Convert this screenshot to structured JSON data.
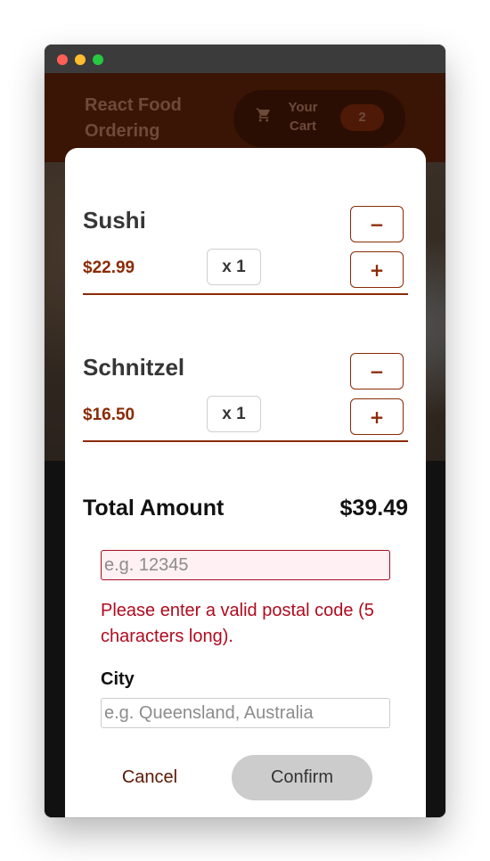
{
  "header": {
    "title": "React Food Ordering",
    "cart_button": {
      "label": "Your Cart",
      "badge": "2",
      "icon": "cart-icon"
    }
  },
  "cart": {
    "items": [
      {
        "name": "Sushi",
        "price": "$22.99",
        "quantity": "x 1",
        "remove_label": "−",
        "add_label": "+"
      },
      {
        "name": "Schnitzel",
        "price": "$16.50",
        "quantity": "x 1",
        "remove_label": "−",
        "add_label": "+"
      }
    ],
    "total_label": "Total Amount",
    "total_value": "$39.49"
  },
  "checkout": {
    "postal_code": {
      "value": "",
      "placeholder": "e.g. 12345",
      "error": "Please enter a valid postal code (5 characters long)."
    },
    "city": {
      "label": "City",
      "value": "",
      "placeholder": "e.g. Queensland, Australia"
    }
  },
  "actions": {
    "cancel_label": "Cancel",
    "confirm_label": "Confirm"
  },
  "colors": {
    "accent": "#8a2b06",
    "error": "#b00b1e",
    "error_bg": "#fff0f3",
    "header_bg": "#3a1405"
  }
}
